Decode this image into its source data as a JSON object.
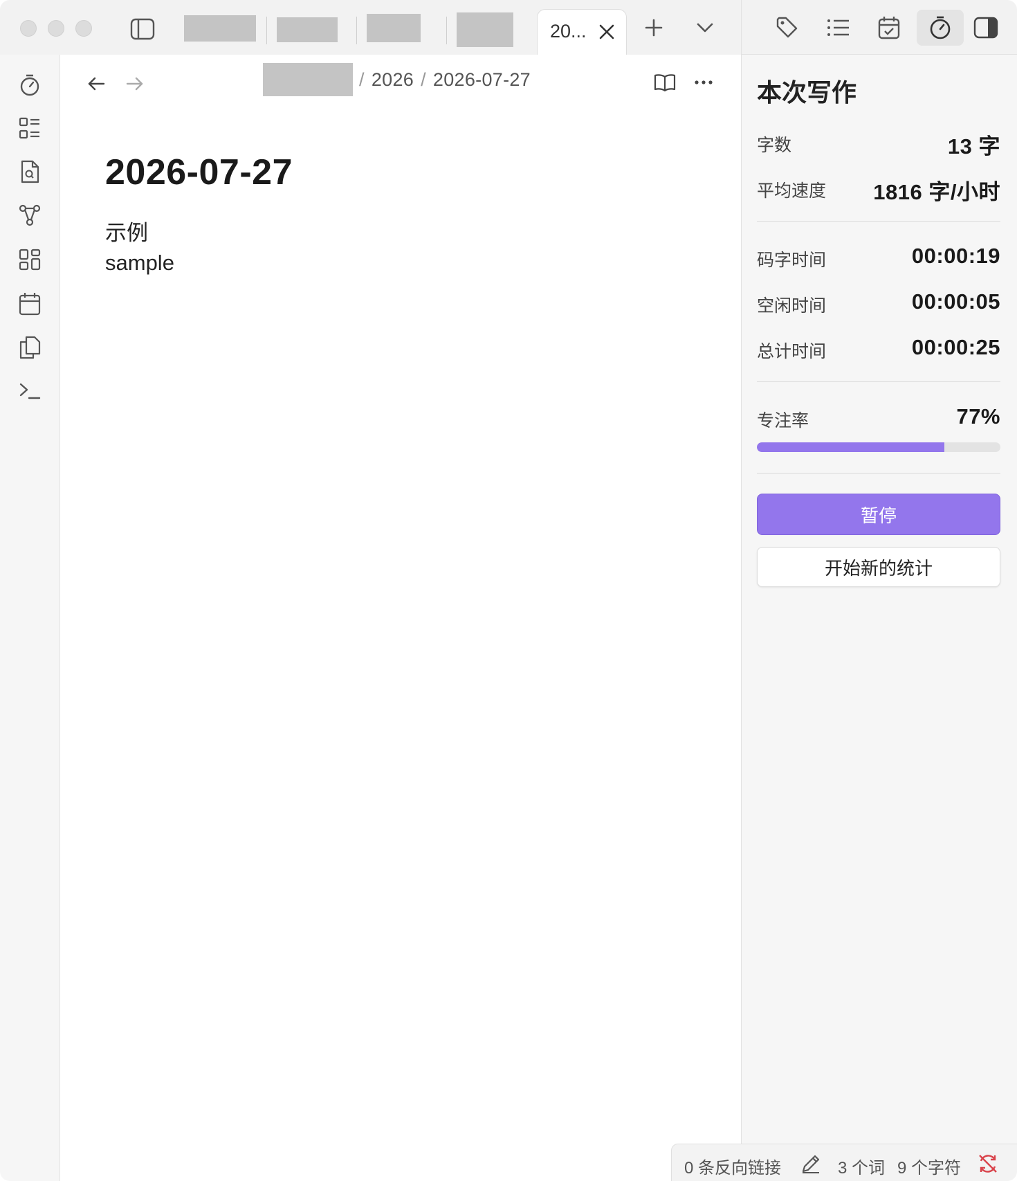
{
  "tabs": {
    "active_tab_title": "20..."
  },
  "breadcrumb": {
    "segment_year": "2026",
    "segment_note": "2026-07-27",
    "separator": "/"
  },
  "document": {
    "title": "2026-07-27",
    "lines": [
      "示例",
      "sample"
    ]
  },
  "sidebar": {
    "heading": "本次写作",
    "stats": {
      "word_count_label": "字数",
      "word_count_value": "13 字",
      "speed_label": "平均速度",
      "speed_value": "1816 字/小时",
      "typing_time_label": "码字时间",
      "typing_time_value": "00:00:19",
      "idle_time_label": "空闲时间",
      "idle_time_value": "00:00:05",
      "total_time_label": "总计时间",
      "total_time_value": "00:00:25",
      "focus_label": "专注率",
      "focus_value": "77%",
      "focus_fraction": 0.77
    },
    "pause_button": "暂停",
    "new_session_button": "开始新的统计"
  },
  "statusbar": {
    "backlinks": "0 条反向链接",
    "words": "3 个词",
    "chars": "9 个字符"
  },
  "colors": {
    "accent": "#9376ec",
    "sync_error": "#d9434b"
  }
}
